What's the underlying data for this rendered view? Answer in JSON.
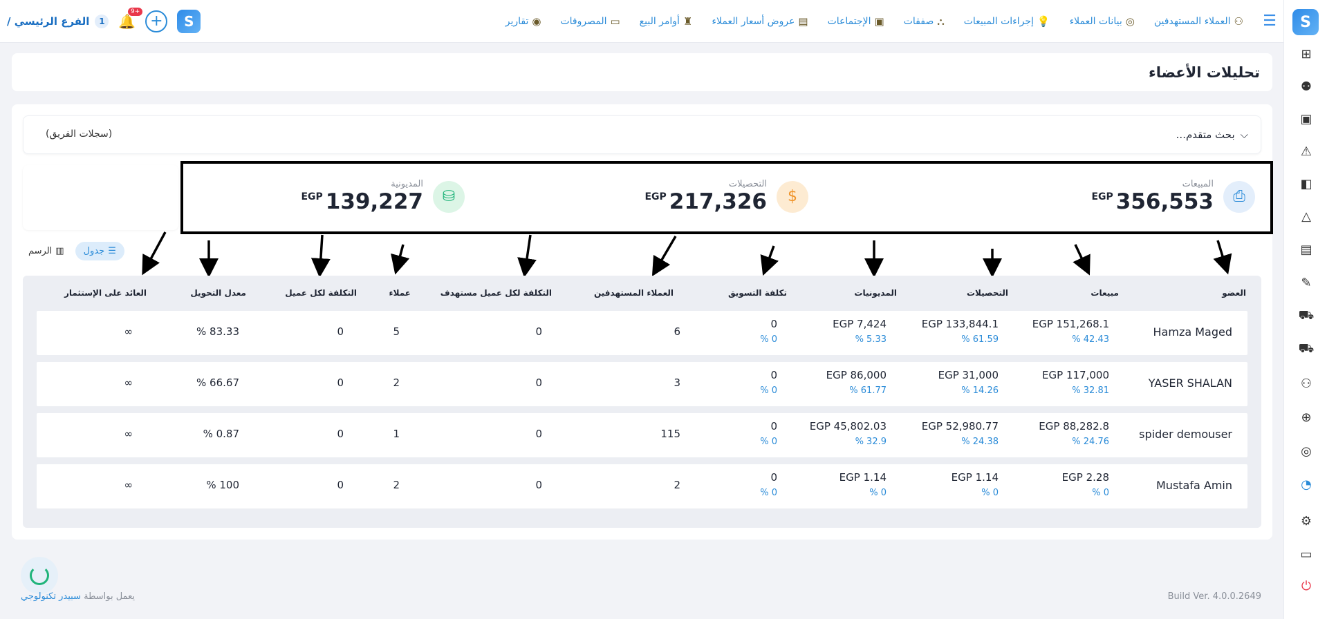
{
  "topbar": {
    "nav": [
      {
        "label": "العملاء المستهدفين",
        "icon": "targets-icon"
      },
      {
        "label": "بيانات العملاء",
        "icon": "customer-data-icon"
      },
      {
        "label": "إجراءات المبيعات",
        "icon": "sales-actions-icon"
      },
      {
        "label": "صفقات",
        "icon": "deals-icon"
      },
      {
        "label": "الإجتماعات",
        "icon": "meetings-icon"
      },
      {
        "label": "عروض أسعار العملاء",
        "icon": "quotes-icon"
      },
      {
        "label": "أوامر البيع",
        "icon": "sales-orders-icon"
      },
      {
        "label": "المصروفات",
        "icon": "expenses-icon"
      },
      {
        "label": "تقارير",
        "icon": "reports-icon"
      }
    ],
    "branch": {
      "number": "1",
      "label": "الفرع الرئيسي /"
    },
    "notification_count": "+9"
  },
  "page": {
    "title": "تحليلات الأعضاء"
  },
  "search": {
    "advanced_label": "بحث متقدم...",
    "team_logs": "(سجلات الفريق)"
  },
  "stats": {
    "currency": "EGP",
    "sales": {
      "label": "المبيعات",
      "value": "356,553"
    },
    "collections": {
      "label": "التحصيلات",
      "value": "217,326"
    },
    "debts": {
      "label": "المديونية",
      "value": "139,227"
    }
  },
  "view_toggle": {
    "table": "جدول",
    "chart": "الرسم"
  },
  "table": {
    "headers": {
      "member": "العضو",
      "sales": "مبيعات",
      "collections": "التحصيلات",
      "debts": "المديونيات",
      "marketing_cost": "تكلفة التسويق",
      "targeted_customers": "العملاء المستهدفين",
      "cost_per_target": "التكلفة لكل عميل مستهدف",
      "customers": "عملاء",
      "cost_per_customer": "التكلفة لكل عميل",
      "conversion_rate": "معدل التحويل",
      "roi": "العائد على الإستثمار"
    },
    "rows": [
      {
        "member": "Hamza Maged",
        "sales": "EGP 151,268.1",
        "sales_pct": "% 42.43",
        "collections": "EGP 133,844.1",
        "collections_pct": "% 61.59",
        "debts": "EGP 7,424",
        "debts_pct": "% 5.33",
        "marketing": "0",
        "marketing_pct": "% 0",
        "targeted": "6",
        "cost_target": "0",
        "customers": "5",
        "cost_customer": "0",
        "conversion": "% 83.33",
        "roi": "∞"
      },
      {
        "member": "YASER SHALAN",
        "sales": "EGP 117,000",
        "sales_pct": "% 32.81",
        "collections": "EGP 31,000",
        "collections_pct": "% 14.26",
        "debts": "EGP 86,000",
        "debts_pct": "% 61.77",
        "marketing": "0",
        "marketing_pct": "% 0",
        "targeted": "3",
        "cost_target": "0",
        "customers": "2",
        "cost_customer": "0",
        "conversion": "% 66.67",
        "roi": "∞"
      },
      {
        "member": "spider demouser",
        "sales": "EGP 88,282.8",
        "sales_pct": "% 24.76",
        "collections": "EGP 52,980.77",
        "collections_pct": "% 24.38",
        "debts": "EGP 45,802.03",
        "debts_pct": "% 32.9",
        "marketing": "0",
        "marketing_pct": "% 0",
        "targeted": "115",
        "cost_target": "0",
        "customers": "1",
        "cost_customer": "0",
        "conversion": "% 0.87",
        "roi": "∞"
      },
      {
        "member": "Mustafa Amin",
        "sales": "EGP 2.28",
        "sales_pct": "% 0",
        "collections": "EGP 1.14",
        "collections_pct": "% 0",
        "debts": "EGP 1.14",
        "debts_pct": "% 0",
        "marketing": "0",
        "marketing_pct": "% 0",
        "targeted": "2",
        "cost_target": "0",
        "customers": "2",
        "cost_customer": "0",
        "conversion": "% 100",
        "roi": "∞"
      }
    ]
  },
  "footer": {
    "build": "Build Ver. 4.0.0.2649",
    "powered_prefix": "يعمل بواسطة",
    "powered_brand": "سبيدر تكنولوجي"
  },
  "colors": {
    "accent": "#2a8bd8",
    "text": "#1f2533",
    "muted": "#8a8f99"
  }
}
